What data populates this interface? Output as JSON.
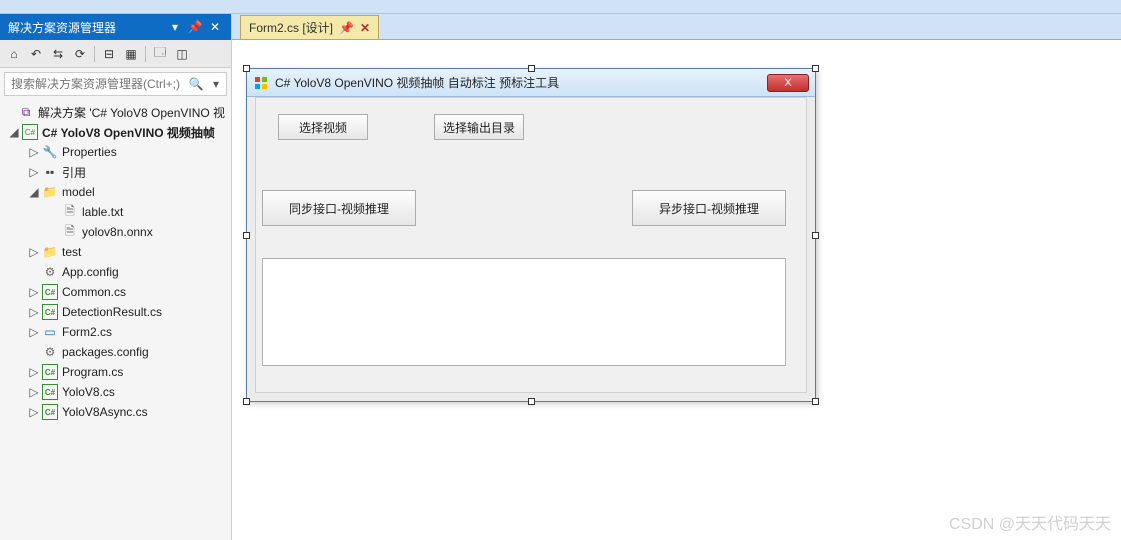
{
  "panel": {
    "title": "解决方案资源管理器",
    "search_placeholder": "搜索解决方案资源管理器(Ctrl+;)"
  },
  "tree": {
    "solution": "解决方案 'C# YoloV8 OpenVINO 视",
    "project": "C# YoloV8 OpenVINO 视频抽帧",
    "properties": "Properties",
    "references": "引用",
    "model": "model",
    "lable": "lable.txt",
    "onnx": "yolov8n.onnx",
    "test": "test",
    "appconfig": "App.config",
    "common": "Common.cs",
    "detection": "DetectionResult.cs",
    "form2": "Form2.cs",
    "packages": "packages.config",
    "program": "Program.cs",
    "yolov8": "YoloV8.cs",
    "yolov8async": "YoloV8Async.cs"
  },
  "tab": {
    "label": "Form2.cs [设计]"
  },
  "form": {
    "title": "C# YoloV8 OpenVINO 视频抽帧 自动标注 预标注工具",
    "btn_select_video": "选择视频",
    "btn_select_output": "选择输出目录",
    "btn_sync": "同步接口-视频推理",
    "btn_async": "异步接口-视频推理",
    "close": "X"
  },
  "watermark": "CSDN @天天代码天天"
}
